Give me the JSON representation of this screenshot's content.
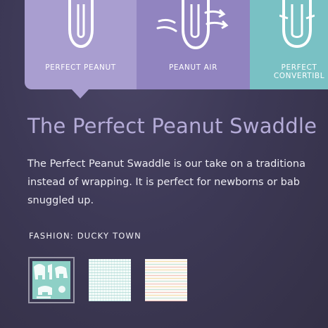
{
  "tabs": [
    {
      "label_lines": [
        "PERFECT PEANUT"
      ],
      "icon": "peanut-swaddle-icon",
      "color": "#a99ed0",
      "selected": true
    },
    {
      "label_lines": [
        "PEANUT AIR"
      ],
      "icon": "peanut-air-swaddle-icon",
      "color": "#9184c0",
      "selected": false
    },
    {
      "label_lines": [
        "PERFECT",
        "CONVERTIBL"
      ],
      "icon": "convertible-swaddle-icon",
      "color": "#79c1c4",
      "selected": false
    }
  ],
  "product": {
    "title": "The Perfect Peanut Swaddle",
    "description_lines": [
      "The Perfect Peanut Swaddle is our take on a traditiona",
      "instead of wrapping.  It is perfect for newborns or bab",
      "snuggled up."
    ]
  },
  "fashion": {
    "label": "FASHION: DUCKY TOWN",
    "swatches": [
      {
        "name": "ducky-town-swatch",
        "selected": true
      },
      {
        "name": "mint-grid-swatch",
        "selected": false
      },
      {
        "name": "pastel-stripe-swatch",
        "selected": false
      }
    ]
  },
  "colors": {
    "accent_purple": "#a99ed0",
    "title_lavender": "#b5acd8",
    "teal": "#79c1c4"
  }
}
